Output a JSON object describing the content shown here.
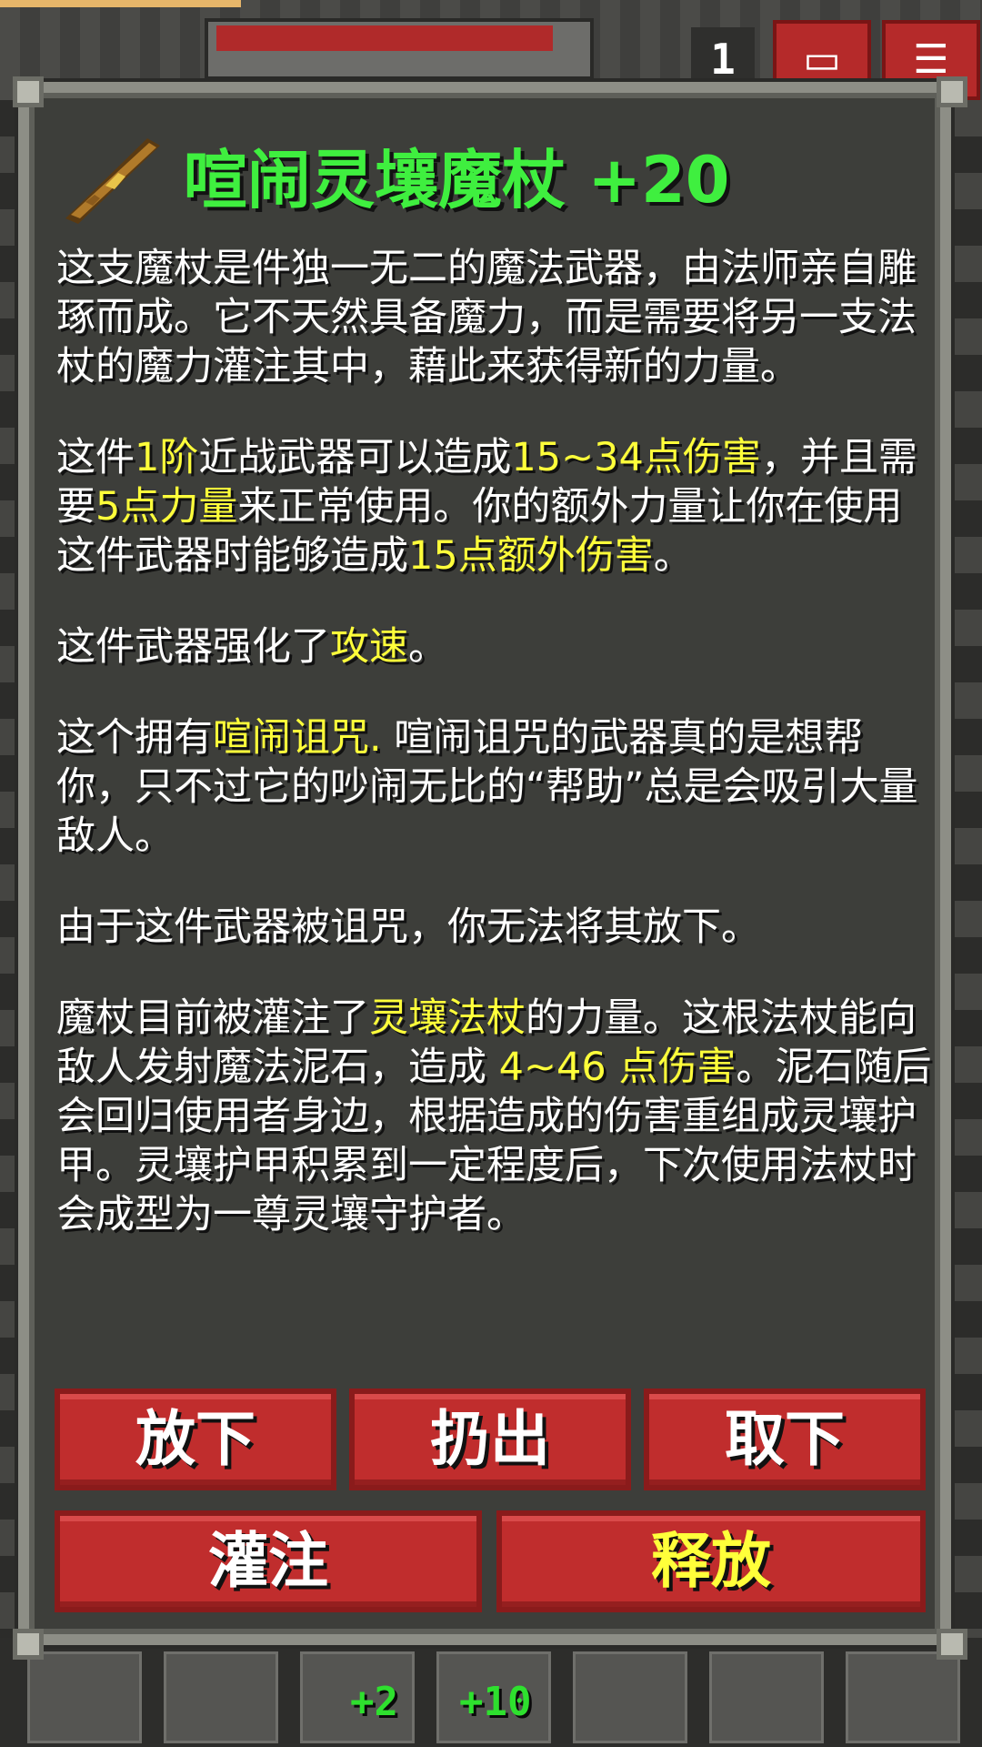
{
  "hud": {
    "depth": "1"
  },
  "item": {
    "name": "喧闹灵壤魔杖 +20",
    "icon": "wand-icon"
  },
  "description": {
    "p1": "这支魔杖是件独一无二的魔法武器，由法师亲自雕琢而成。它不天然具备魔力，而是需要将另一支法杖的魔力灌注其中，藉此来获得新的力量。",
    "p2": {
      "t1": "这件",
      "h1": "1阶",
      "t2": "近战武器可以造成",
      "h2": "15~34点伤害",
      "t3": "，并且需要",
      "h3": "5点力量",
      "t4": "来正常使用。你的额外力量让你在使用这件武器时能够造成",
      "h4": "15点额外伤害",
      "t5": "。"
    },
    "p3": {
      "t1": "这件武器强化了",
      "h1": "攻速",
      "t2": "。"
    },
    "p4": {
      "t1": "这个拥有",
      "h1": "喧闹诅咒.",
      "t2": " 喧闹诅咒的武器真的是想帮你，只不过它的吵闹无比的“帮助”总是会吸引大量敌人。"
    },
    "p5": "由于这件武器被诅咒，你无法将其放下。",
    "p6": {
      "t1": "魔杖目前被灌注了",
      "h1": "灵壤法杖",
      "t2": "的力量。这根法杖能向敌人发射魔法泥石，造成 ",
      "h2": "4~46 点伤害",
      "t3": "。泥石随后会回归使用者身边，根据造成的伤害重组成灵壤护甲。灵壤护甲积累到一定程度后，下次使用法杖时会成型为一尊灵壤守护者。"
    }
  },
  "buttons": {
    "drop": "放下",
    "throw": "扔出",
    "unequip": "取下",
    "imbue": "灌注",
    "release": "释放"
  },
  "toolbar": {
    "slot3_badge": "+2",
    "slot4_badge": "+10"
  },
  "colors": {
    "title": "#3fef3f",
    "highlight": "#ffff3a",
    "button": "#c02d2d"
  }
}
